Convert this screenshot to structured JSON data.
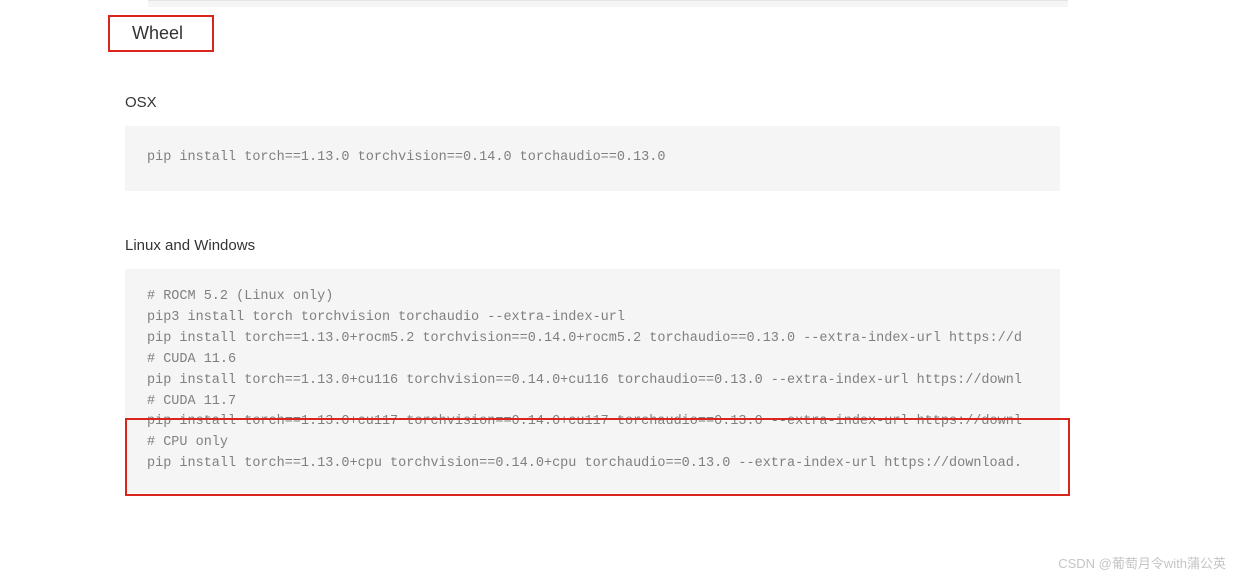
{
  "headings": {
    "wheel": "Wheel",
    "osx": "OSX",
    "linux_windows": "Linux and Windows"
  },
  "code_osx": "pip install torch==1.13.0 torchvision==0.14.0 torchaudio==0.13.0",
  "code_linux_windows": "# ROCM 5.2 (Linux only)\npip3 install torch torchvision torchaudio --extra-index-url\npip install torch==1.13.0+rocm5.2 torchvision==0.14.0+rocm5.2 torchaudio==0.13.0 --extra-index-url https://d\n# CUDA 11.6\npip install torch==1.13.0+cu116 torchvision==0.14.0+cu116 torchaudio==0.13.0 --extra-index-url https://downl\n# CUDA 11.7\npip install torch==1.13.0+cu117 torchvision==0.14.0+cu117 torchaudio==0.13.0 --extra-index-url https://downl\n# CPU only\npip install torch==1.13.0+cpu torchvision==0.14.0+cpu torchaudio==0.13.0 --extra-index-url https://download.",
  "watermark": "CSDN @葡萄月令with蒲公英"
}
